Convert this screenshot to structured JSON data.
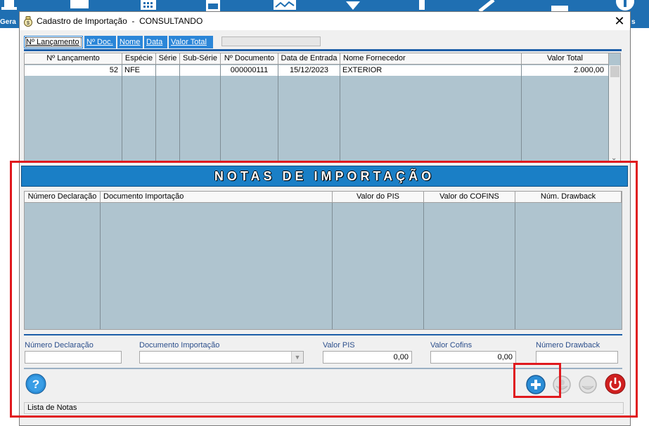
{
  "app_toolbar": {
    "left_label": "Gera",
    "right_label": "s",
    "icons": [
      "users-icon",
      "chat-icon",
      "calendar-icon",
      "calculator-icon",
      "chart-icon",
      "download-icon",
      "upload-icon",
      "tool-icon",
      "log-icon",
      "add-icon"
    ],
    "background": "#1f6fb2"
  },
  "dialog": {
    "title": "Cadastro de Importação  -  CONSULTANDO",
    "icon": "money-bag-icon",
    "close_label": "✕"
  },
  "sort_buttons": [
    "Nº Lançamento",
    "Nº Doc.",
    "Nome",
    "Data",
    "Valor Total"
  ],
  "main_grid": {
    "headers": [
      "Nº Lançamento",
      "Espécie",
      "Série",
      "Sub-Série",
      "Nº Documento",
      "Data de Entrada",
      "Nome Fornecedor",
      "Valor Total"
    ],
    "rows": [
      [
        "52",
        "NFE",
        "",
        "",
        "000000111",
        "15/12/2023",
        "EXTERIOR",
        "2.000,00"
      ]
    ]
  },
  "notas": {
    "banner": "NOTAS DE IMPORTAÇÃO",
    "grid_headers": [
      "Número Declaração",
      "Documento Importação",
      "Valor do PIS",
      "Valor do COFINS",
      "Núm. Drawback"
    ],
    "rows": []
  },
  "form": {
    "numero_declaracao": {
      "label": "Número Declaração",
      "value": ""
    },
    "documento_importacao": {
      "label": "Documento Importação",
      "value": ""
    },
    "valor_pis": {
      "label": "Valor PIS",
      "value": "0,00"
    },
    "valor_cofins": {
      "label": "Valor Cofins",
      "value": "0,00"
    },
    "numero_drawback": {
      "label": "Número Drawback",
      "value": ""
    }
  },
  "buttons": {
    "help": "help-icon",
    "add": "add-icon",
    "edit": "edit-icon",
    "delete": "delete-icon",
    "exit": "power-icon"
  },
  "status_text": "Lista de Notas",
  "colors": {
    "accent": "#1a7fc6",
    "grid_bg": "#afc4cf",
    "highlight": "#e0191e",
    "exit": "#d02020"
  }
}
